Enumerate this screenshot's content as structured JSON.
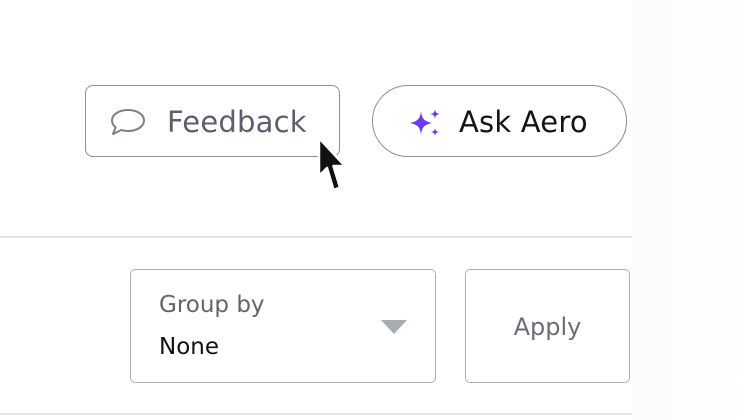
{
  "toolbar": {
    "feedback": {
      "label": "Feedback",
      "icon": "chat-bubble-icon"
    },
    "ask": {
      "label": "Ask Aero",
      "icon": "sparkles-icon",
      "icon_color": "#6c3ce6"
    }
  },
  "filters": {
    "group_by": {
      "label": "Group by",
      "value": "None"
    },
    "apply_label": "Apply"
  },
  "colors": {
    "border": "#8c8f96",
    "text_muted": "#5b5f69",
    "accent": "#6c3ce6"
  }
}
